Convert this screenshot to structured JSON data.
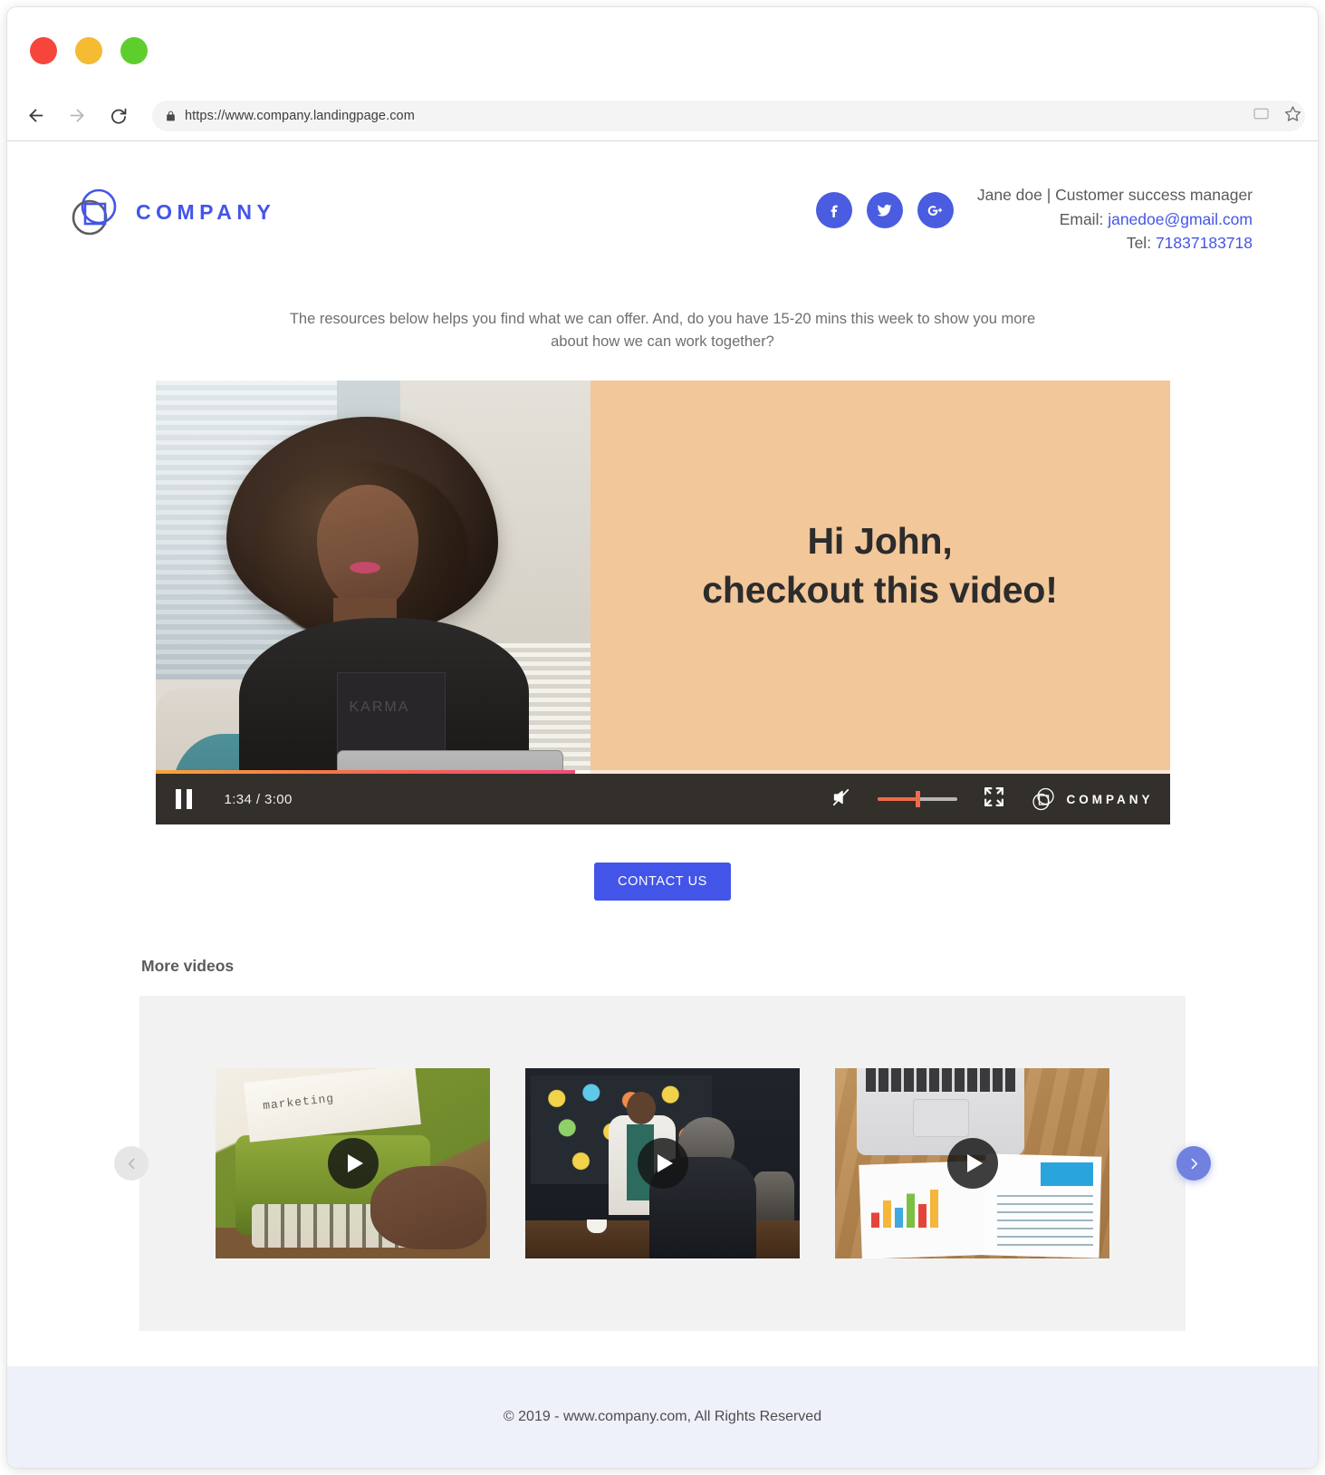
{
  "browser": {
    "url": "https://www.company.landingpage.com",
    "back_icon": "back-arrow-icon",
    "forward_icon": "forward-arrow-icon",
    "reload_icon": "reload-icon",
    "lock_icon": "lock-icon",
    "cast_icon": "cast-icon",
    "star_icon": "star-icon"
  },
  "header": {
    "logo_text": "COMPANY",
    "socials": [
      {
        "name": "facebook",
        "glyph": "f"
      },
      {
        "name": "twitter",
        "glyph": "twitter-bird"
      },
      {
        "name": "google-plus",
        "glyph": "G+"
      }
    ],
    "contact": {
      "person": "Jane doe | Customer success manager",
      "email_label": "Email:",
      "email": "janedoe@gmail.com",
      "tel_label": "Tel:",
      "tel": "71837183718"
    }
  },
  "intro": {
    "text": "The resources below helps you find what we can offer. And, do you have 15-20 mins this week to show you more about how we can work together?"
  },
  "video": {
    "headline_line1": "Hi John,",
    "headline_line2": "checkout this video!",
    "shirt_print": "KARMA",
    "current_time": "1:34",
    "total_time": "3:00",
    "time_display": "1:34 / 3:00",
    "progress_percent": 41.4,
    "volume_percent": 50,
    "muted": true,
    "pause_icon": "pause-icon",
    "mute_icon": "mute-speaker-icon",
    "fullscreen_icon": "fullscreen-icon",
    "brand_text": "COMPANY",
    "bg_color": "#f2c79a",
    "controls_bg": "#332f2b",
    "progress_color": "#ef4b78",
    "volume_color": "#ef6b4b"
  },
  "cta": {
    "label": "CONTACT US",
    "color": "#4355e8"
  },
  "more_videos": {
    "title": "More videos",
    "prev_icon": "chevron-left-icon",
    "next_icon": "chevron-right-icon",
    "thumbnails": [
      {
        "name": "typewriter-marketing-video",
        "caption_in_image": "marketing",
        "play_icon": "play-icon"
      },
      {
        "name": "office-meeting-video",
        "caption_in_image": "",
        "play_icon": "play-icon"
      },
      {
        "name": "laptop-report-video",
        "caption_in_image": "",
        "play_icon": "play-icon"
      }
    ]
  },
  "footer": {
    "text": "© 2019 - www.company.com, All Rights Reserved",
    "bg_color": "#eef1fa"
  },
  "colors": {
    "brand_blue": "#4355e8",
    "social_blue": "#4a5ce0",
    "next_arrow_blue": "#7081e0",
    "prev_arrow_gray": "#e6e6e6"
  }
}
